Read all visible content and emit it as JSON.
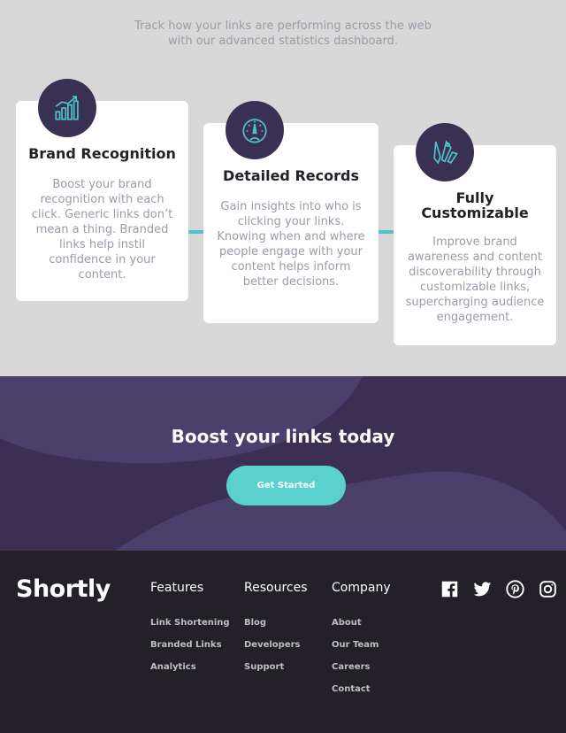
{
  "stats": {
    "intro": "Track how your links are performing across the web with our advanced statistics dashboard.",
    "cards": [
      {
        "title": "Brand Recognition",
        "icon": "chart-icon",
        "text": "Boost your brand recognition with each click. Generic links don’t mean a thing. Branded links help instil confidence in your content."
      },
      {
        "title": "Detailed Records",
        "icon": "gauge-icon",
        "text": "Gain insights into who is clicking your links. Knowing when and where people engage with your content helps inform better decisions."
      },
      {
        "title": "Fully Customizable",
        "icon": "tools-icon",
        "text": "Improve brand awareness and content discoverability through customizable links, supercharging audience engagement."
      }
    ]
  },
  "boost": {
    "title": "Boost your links today",
    "cta_label": "Get Started"
  },
  "footer": {
    "logo": "Shortly",
    "columns": [
      {
        "heading": "Features",
        "links": [
          "Link Shortening",
          "Branded Links",
          "Analytics"
        ]
      },
      {
        "heading": "Resources",
        "links": [
          "Blog",
          "Developers",
          "Support"
        ]
      },
      {
        "heading": "Company",
        "links": [
          "About",
          "Our Team",
          "Careers",
          "Contact"
        ]
      }
    ],
    "social": [
      "facebook-icon",
      "twitter-icon",
      "pinterest-icon",
      "instagram-icon"
    ]
  },
  "colors": {
    "page_bg": "#d8d8d8",
    "dark_violet": "#3b3054",
    "cyan": "#5ad0cf",
    "footer_bg": "#232127",
    "grayish_violet": "#9e9aa7"
  }
}
